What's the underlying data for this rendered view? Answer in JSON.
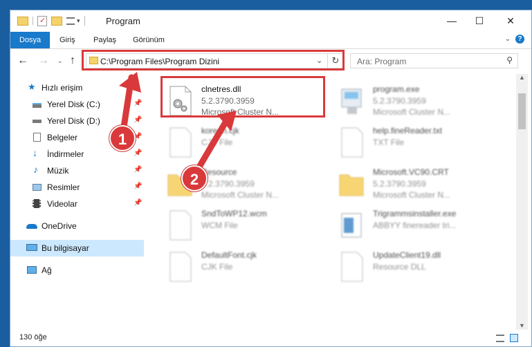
{
  "window": {
    "title": "Program",
    "controls": {
      "minimize": "—",
      "maximize": "☐",
      "close": "✕"
    }
  },
  "ribbon": {
    "tabs": [
      "Dosya",
      "Giriş",
      "Paylaş",
      "Görünüm"
    ]
  },
  "address": {
    "path": "C:\\Program Files\\Program Dizini"
  },
  "search": {
    "placeholder": "Ara: Program"
  },
  "sidebar": {
    "items": [
      {
        "label": "Hızlı erişim",
        "icon": "star-icon"
      },
      {
        "label": "Yerel Disk (C:)",
        "icon": "drive-icon"
      },
      {
        "label": "Yerel Disk (D:)",
        "icon": "drive-icon"
      },
      {
        "label": "Belgeler",
        "icon": "documents-icon"
      },
      {
        "label": "İndirmeler",
        "icon": "download-icon"
      },
      {
        "label": "Müzik",
        "icon": "music-icon"
      },
      {
        "label": "Resimler",
        "icon": "pictures-icon"
      },
      {
        "label": "Videolar",
        "icon": "video-icon"
      },
      {
        "label": "OneDrive",
        "icon": "cloud-icon"
      },
      {
        "label": "Bu bilgisayar",
        "icon": "computer-icon"
      },
      {
        "label": "Ağ",
        "icon": "network-icon"
      }
    ]
  },
  "files": [
    {
      "name": "clnetres.dll",
      "line2": "5.2.3790.3959",
      "line3": "Microsoft Cluster N...",
      "icon": "dll-file-icon"
    },
    {
      "name": "program.exe",
      "line2": "5.2.3790.3959",
      "line3": "Microsoft Cluster N...",
      "icon": "exe-file-icon"
    },
    {
      "name": "korean.cjk",
      "line2": "CJK File",
      "line3": "",
      "icon": "blank-file-icon"
    },
    {
      "name": "help.fineReader.txt",
      "line2": "TXT File",
      "line3": "",
      "icon": "blank-file-icon"
    },
    {
      "name": "Resource",
      "line2": "5.2.3790.3959",
      "line3": "Microsoft Cluster N...",
      "icon": "folder-icon"
    },
    {
      "name": "Microsoft.VC90.CRT",
      "line2": "5.2.3790.3959",
      "line3": "Microsoft Cluster N...",
      "icon": "folder-icon"
    },
    {
      "name": "SndToWP12.wcm",
      "line2": "WCM File",
      "line3": "",
      "icon": "blank-file-icon"
    },
    {
      "name": "Trigrammsinstaller.exe",
      "line2": "ABBYY finereader tri...",
      "line3": "",
      "icon": "installer-icon"
    },
    {
      "name": "DefaultFont.cjk",
      "line2": "CJK File",
      "line3": "",
      "icon": "blank-file-icon"
    },
    {
      "name": "UpdateClient19.dll",
      "line2": "Resource DLL",
      "line3": "",
      "icon": "blank-file-icon"
    }
  ],
  "status": {
    "count": "130 öğe"
  },
  "annotations": {
    "step1": "1",
    "step2": "2"
  },
  "colors": {
    "highlight": "#d9393b",
    "accent": "#1979ca",
    "selected": "#cce8ff"
  }
}
